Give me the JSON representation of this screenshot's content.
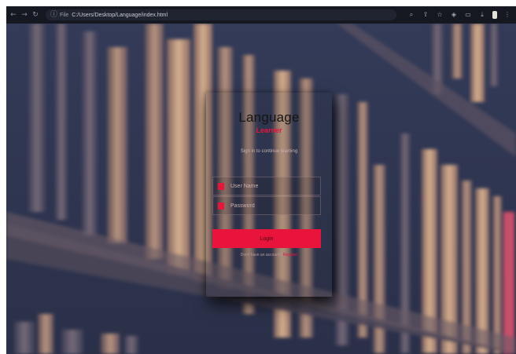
{
  "browser": {
    "back_icon": "arrow-left-icon",
    "forward_icon": "arrow-right-icon",
    "reload_icon": "reload-icon",
    "info_icon": "info-icon",
    "scheme": "File",
    "url": "C:/Users/Desktop/Language/index.html",
    "toolbar_icons": [
      "zoom-icon",
      "share-icon",
      "star-icon",
      "extensions-icon",
      "tab-search-icon",
      "download-icon",
      "menu-icon"
    ]
  },
  "login": {
    "title": "Language",
    "subtitle": "Learner",
    "tagline": "Sign in to continue learning",
    "username_placeholder": "User Name",
    "password_placeholder": "Password",
    "login_button": "Login",
    "register_prompt": "Don't have an account?",
    "register_link": "Register"
  },
  "colors": {
    "accent": "#e8143c",
    "background": "#2c3450",
    "browser_bar": "#151820"
  }
}
